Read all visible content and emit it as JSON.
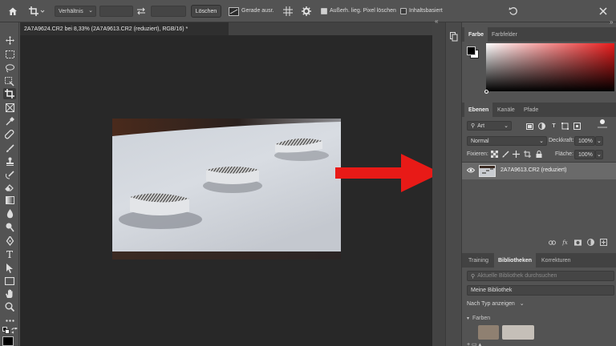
{
  "options_bar": {
    "ratio_label": "Verhältnis",
    "clear_button": "Löschen",
    "straighten_label": "Gerade ausr.",
    "delete_outer_pixels_label": "Außerh. lieg. Pixel löschen",
    "content_aware_label": "Inhaltsbasiert"
  },
  "document": {
    "tab_title": "2A7A9624.CR2 bei 8,33% (2A7A9613.CR2 (reduziert), RGB/16) *"
  },
  "color_panel": {
    "tabs": [
      "Farbe",
      "Farbfelder"
    ]
  },
  "layers_panel": {
    "tabs": [
      "Ebenen",
      "Kanäle",
      "Pfade"
    ],
    "filter_kind": "Art",
    "blend_mode": "Normal",
    "opacity_label": "Deckkraft:",
    "opacity_value": "100%",
    "lock_label": "Fixieren:",
    "fill_label": "Fläche:",
    "fill_value": "100%",
    "layer_name": "2A7A9613.CR2 (reduziert)"
  },
  "libraries_panel": {
    "tabs": [
      "Training",
      "Bibliotheken",
      "Korrekturen"
    ],
    "search_placeholder": "Aktuelle Bibliothek durchsuchen",
    "library_name": "Meine Bibliothek",
    "filter_label": "Nach Typ anzeigen",
    "section_colors": "Farben",
    "swatches": [
      "#8f8071",
      "#c5bfb8"
    ]
  },
  "colors": {
    "arrow": "#e81a17",
    "active_tab": "#535353",
    "canvas_bg": "#282828"
  }
}
